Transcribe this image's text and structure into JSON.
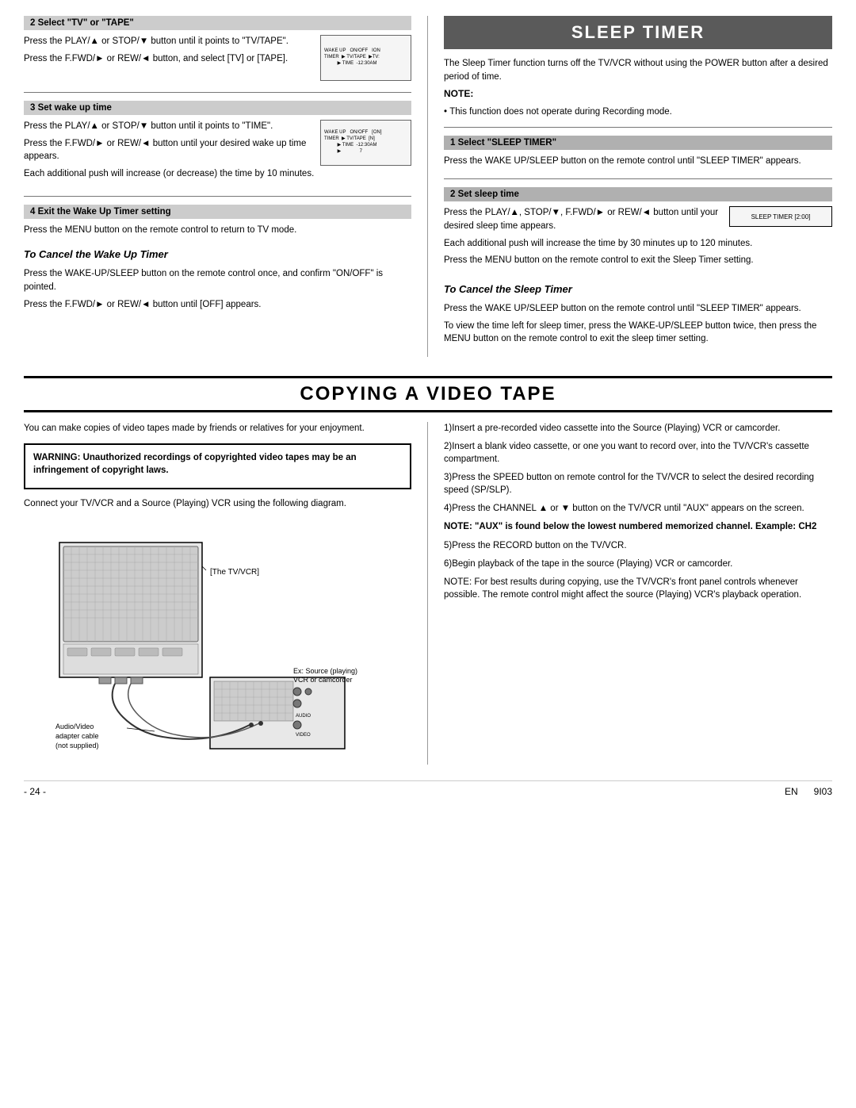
{
  "sleepTimer": {
    "header": "SLEEP TIMER",
    "intro": "The Sleep Timer function turns off the TV/VCR without using the POWER button after a desired period of time.",
    "note_label": "NOTE:",
    "note_text": "This function does not operate during Recording mode.",
    "step1_header": "1  Select \"SLEEP TIMER\"",
    "step1_text": "Press the WAKE UP/SLEEP button on the remote control until \"SLEEP TIMER\" appears.",
    "step2_header": "2  Set sleep time",
    "step2_text1": "Press the PLAY/▲, STOP/▼, F.FWD/► or REW/◄ button until your desired sleep time appears.",
    "step2_text2": "Each additional push will increase the time by 30 minutes up to 120 minutes.",
    "step2_text3": "Press the MENU button on the remote control to exit the Sleep Timer setting.",
    "cancel_header": "To Cancel the Sleep Timer",
    "cancel_text1": "Press the WAKE UP/SLEEP button on the remote control until \"SLEEP TIMER\" appears.",
    "cancel_text2": "To view the time left for sleep timer, press the WAKE-UP/SLEEP button twice, then press the MENU button on the remote control to exit the sleep timer setting.",
    "sleep_diagram_text": "SLEEP TIMER  [2:00]"
  },
  "wakeUpTimer": {
    "step2_header": "2  Select \"TV\" or \"TAPE\"",
    "step2_text1": "Press the PLAY/▲ or STOP/▼ button until it points to \"TV/TAPE\".",
    "step2_text2": "Press the F.FWD/► or REW/◄ button, and select [TV] or [TAPE].",
    "step3_header": "3  Set wake up time",
    "step3_text1": "Press the PLAY/▲ or STOP/▼ button until it points to \"TIME\".",
    "step3_text2": "Press the F.FWD/► or REW/◄ button until your desired wake up time appears.",
    "step3_text3": "Each additional push will increase (or decrease) the time by 10 minutes.",
    "step4_header": "4  Exit the Wake Up Timer setting",
    "step4_text": "Press the MENU button on the remote control to return to TV mode.",
    "cancel_header": "To Cancel the Wake Up Timer",
    "cancel_text1": "Press the WAKE-UP/SLEEP button on the remote control once, and confirm \"ON/OFF\" is pointed.",
    "cancel_text2": "Press the F.FWD/► or REW/◄ button until [OFF] appears.",
    "diagram2_col1": "WAKE UP",
    "diagram2_col2": "ON/OFF",
    "diagram2_col3": "ION",
    "diagram2_row2_col1": "TIMER",
    "diagram2_row2_col2": "▶  TV/TAPE",
    "diagram2_row2_col3": "▶TV:",
    "diagram2_row3_col2": "▶ TIME",
    "diagram2_row3_col3": "-12:30AM",
    "diagram3_col1": "WAKE UP",
    "diagram3_col2": "ON/OFF",
    "diagram3_col3": "[ON]",
    "diagram3_row2_col1": "TIMER",
    "diagram3_row2_col2": "▶ TV/TAPE",
    "diagram3_row2_col3": "[N]",
    "diagram3_row3_col2": "▶ TIME",
    "diagram3_row3_col3": "-12:30AM",
    "diagram3_row4_col2": "▶",
    "diagram3_row4_col3": "7"
  },
  "copyingVideoTape": {
    "header": "COPYING A VIDEO TAPE",
    "intro": "You can make copies of video tapes made by friends or relatives for your enjoyment.",
    "warning_text": "WARNING: Unauthorized recordings of copyrighted video tapes may be an infringement of copyright laws.",
    "connect_text": "Connect your TV/VCR and a Source (Playing) VCR using the following diagram.",
    "label_tvcvr": "[The TV/VCR]",
    "label_source": "Ex: Source (playing) VCR or camcorder",
    "label_cable": "Audio/Video adapter cable (not supplied)",
    "step1": "1)Insert a pre-recorded video cassette into the Source (Playing) VCR or camcorder.",
    "step2": "2)Insert a blank video cassette, or one you want to record over, into the TV/VCR's cassette compartment.",
    "step3": "3)Press the SPEED button on remote control for the TV/VCR to select the desired recording speed (SP/SLP).",
    "step4": "4)Press the CHANNEL ▲ or ▼ button on the TV/VCR until \"AUX\" appears on the screen.",
    "note_aux": "NOTE: \"AUX\" is found below the lowest numbered memorized channel. Example: CH2",
    "step5": "5)Press the RECORD button on the TV/VCR.",
    "step6": "6)Begin playback of the tape in the source (Playing) VCR or camcorder.",
    "note_best": "NOTE: For best results during copying, use the TV/VCR's front panel controls whenever possible. The remote control might affect the source (Playing) VCR's playback operation."
  },
  "footer": {
    "page_number": "- 24 -",
    "lang": "EN",
    "model": "9I03"
  }
}
